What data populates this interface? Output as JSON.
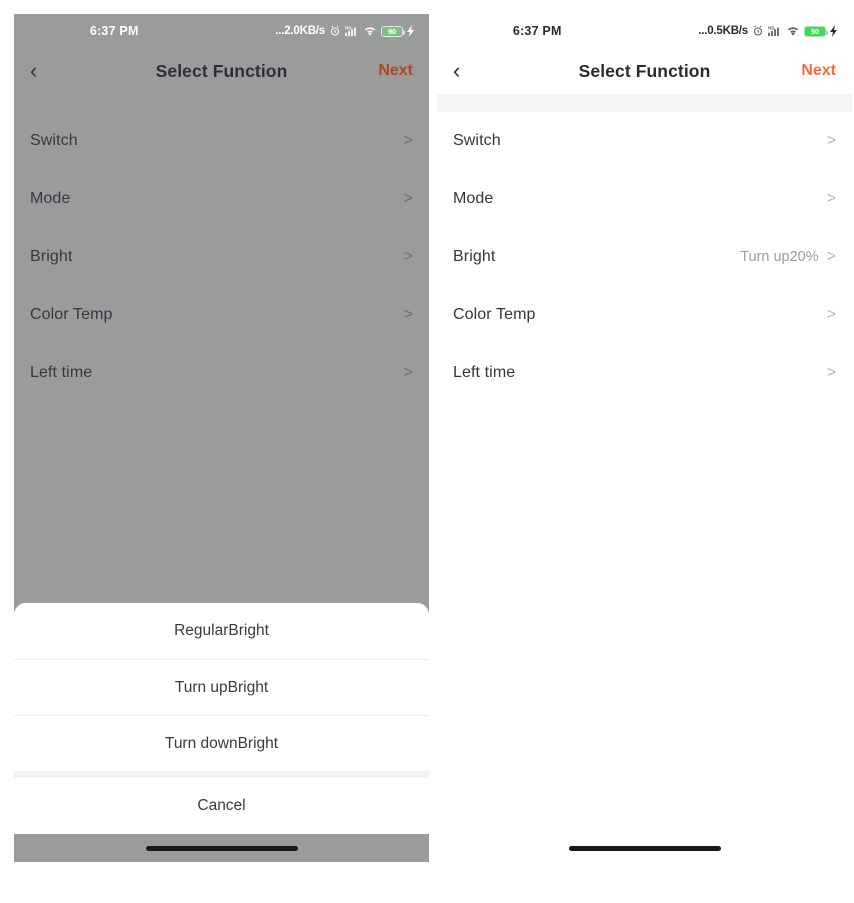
{
  "panels": [
    {
      "id": "left",
      "status": {
        "time": "6:37 PM",
        "network_speed": "...2.0KB/s",
        "alarm_icon": "alarm-clock-icon",
        "signal_icon": "hd-signal-bars-icon",
        "wifi_icon": "wifi-icon",
        "battery_level": "90",
        "charging_icon": "charging-bolt-icon"
      },
      "nav": {
        "back_icon": "chevron-left-icon",
        "title": "Select Function",
        "next_label": "Next",
        "next_color": "#b5451f"
      },
      "rows": [
        {
          "label": "Switch",
          "value": "",
          "chevron": ">"
        },
        {
          "label": "Mode",
          "value": "",
          "chevron": ">"
        },
        {
          "label": "Bright",
          "value": "",
          "chevron": ">"
        },
        {
          "label": "Color Temp",
          "value": "",
          "chevron": ">"
        },
        {
          "label": "Left time",
          "value": "",
          "chevron": ">"
        }
      ],
      "action_sheet": {
        "visible": true,
        "options": [
          "RegularBright",
          "Turn upBright",
          "Turn downBright"
        ],
        "cancel_label": "Cancel"
      }
    },
    {
      "id": "right",
      "status": {
        "time": "6:37 PM",
        "network_speed": "...0.5KB/s",
        "alarm_icon": "alarm-clock-icon",
        "signal_icon": "hd-signal-bars-icon",
        "wifi_icon": "wifi-icon",
        "battery_level": "90",
        "charging_icon": "charging-bolt-icon"
      },
      "nav": {
        "back_icon": "chevron-left-icon",
        "title": "Select Function",
        "next_label": "Next",
        "next_color": "#f96a3c"
      },
      "rows": [
        {
          "label": "Switch",
          "value": "",
          "chevron": ">"
        },
        {
          "label": "Mode",
          "value": "",
          "chevron": ">"
        },
        {
          "label": "Bright",
          "value": "Turn up20%",
          "chevron": ">"
        },
        {
          "label": "Color Temp",
          "value": "",
          "chevron": ">"
        },
        {
          "label": "Left time",
          "value": "",
          "chevron": ">"
        }
      ],
      "action_sheet": {
        "visible": false,
        "options": [],
        "cancel_label": ""
      }
    }
  ],
  "colors": {
    "dimmed_background": "#9a9b9d",
    "panel_background": "#ffffff",
    "accent_next": "#f96a3c",
    "accent_next_dimmed": "#b5451f",
    "section_band": "#f4f5f7",
    "battery_green": "#3ddc57"
  }
}
